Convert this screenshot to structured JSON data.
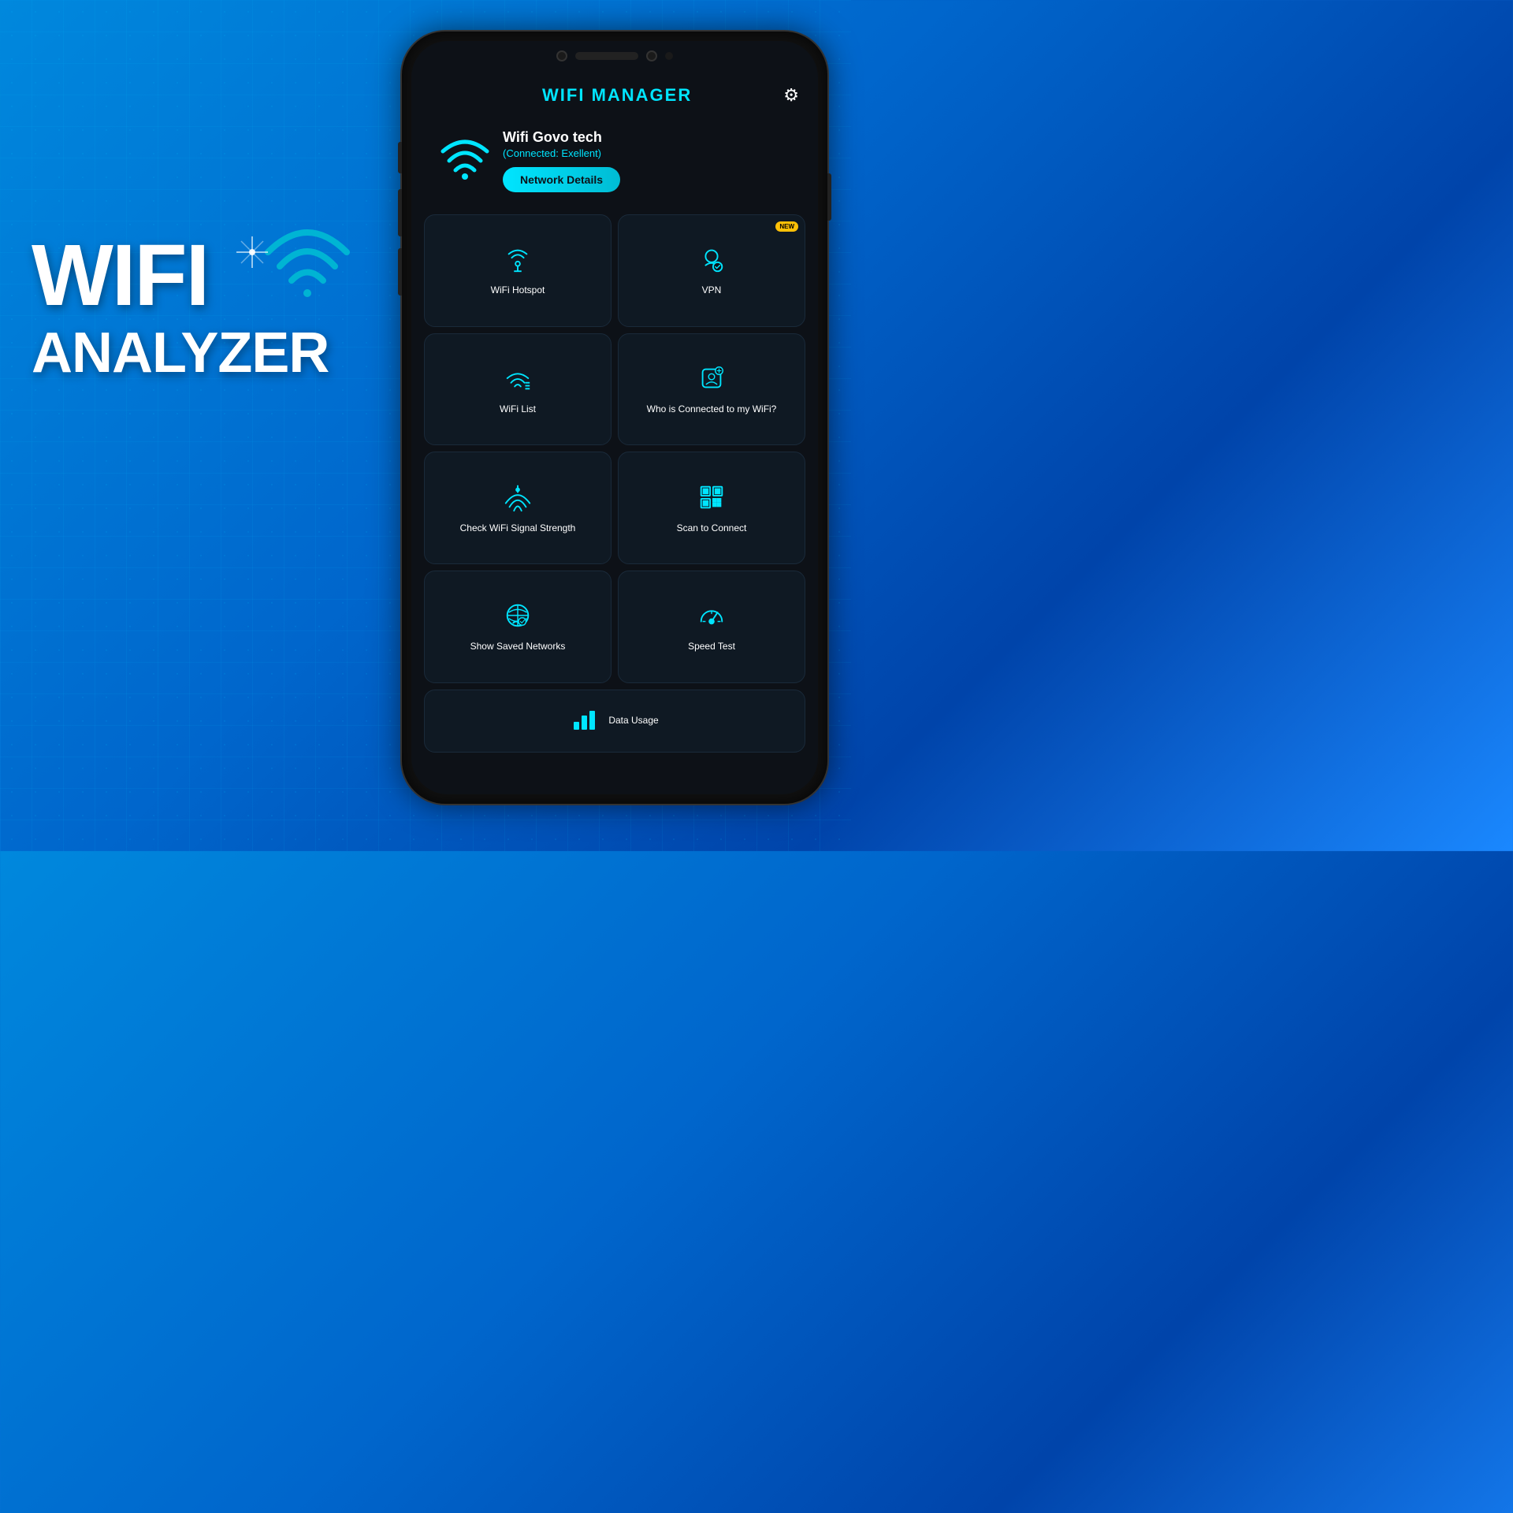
{
  "background": {
    "color_start": "#0088dd",
    "color_end": "#0044aa"
  },
  "branding": {
    "wifi_label": "WIFI",
    "analyzer_label": "ANALYZER"
  },
  "app": {
    "title": "WIFI MANAGER",
    "settings_icon": "⚙"
  },
  "connection": {
    "network_name": "Wifi Govo tech",
    "status": "(Connected: Exellent)",
    "details_button": "Network Details"
  },
  "tiles": [
    {
      "id": "wifi-hotspot",
      "label": "WiFi Hotspot",
      "icon": "hotspot",
      "badge": null,
      "full_width": false
    },
    {
      "id": "vpn",
      "label": "VPN",
      "icon": "vpn",
      "badge": "NEW",
      "full_width": false
    },
    {
      "id": "wifi-list",
      "label": "WiFi List",
      "icon": "wifi-list",
      "badge": null,
      "full_width": false
    },
    {
      "id": "who-connected",
      "label": "Who is Connected to my WiFi?",
      "icon": "who-connected",
      "badge": null,
      "full_width": false
    },
    {
      "id": "signal-strength",
      "label": "Check WiFi Signal Strength",
      "icon": "signal-strength",
      "badge": null,
      "full_width": false
    },
    {
      "id": "scan-connect",
      "label": "Scan to Connect",
      "icon": "qr-scan",
      "badge": null,
      "full_width": false
    },
    {
      "id": "saved-networks",
      "label": "Show Saved Networks",
      "icon": "saved-networks",
      "badge": null,
      "full_width": false
    },
    {
      "id": "speed-test",
      "label": "Speed Test",
      "icon": "speed-test",
      "badge": null,
      "full_width": false
    },
    {
      "id": "data-usage",
      "label": "Data Usage",
      "icon": "data-usage",
      "badge": null,
      "full_width": true
    }
  ]
}
